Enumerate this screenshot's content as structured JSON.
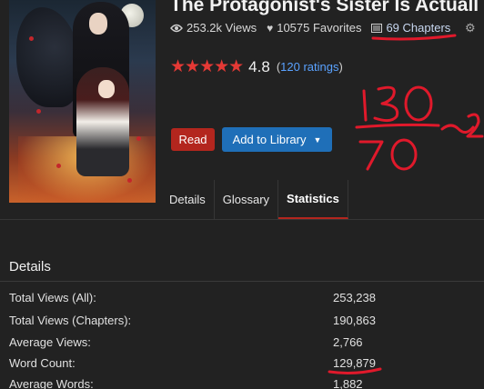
{
  "novel": {
    "title": "The Protagonist's Sister Is Actuall",
    "views": "253.2k Views",
    "favorites": "10575 Favorites",
    "chapters": "69 Chapters",
    "score": "4.8",
    "ratings_open": "(",
    "ratings_link": "120 ratings",
    "ratings_close": ")",
    "stars_glyphs": "★★★★★"
  },
  "icons": {
    "views": "eye-icon",
    "favorites": "heart-icon",
    "chapters": "list-icon",
    "settings": "gear-icon"
  },
  "actions": {
    "read_label": "Read",
    "library_label": "Add to Library"
  },
  "tabs": [
    {
      "label": "Details"
    },
    {
      "label": "Glossary"
    },
    {
      "label": "Statistics",
      "active": true
    }
  ],
  "details": {
    "heading": "Details",
    "rows": [
      {
        "label": "Total Views (All):",
        "value": "253,238"
      },
      {
        "label": "Total Views (Chapters):",
        "value": "190,863"
      },
      {
        "label": "Average Views:",
        "value": "2,766"
      },
      {
        "label": "Word Count:",
        "value": "129,879"
      },
      {
        "label": "Average Words:",
        "value": "1,882"
      }
    ]
  },
  "annotations": {
    "handwriting_top": "130",
    "handwriting_bottom": "70",
    "handwriting_side": "~2",
    "ink_color": "#e0192b"
  },
  "colors": {
    "accent_red": "#b3261e",
    "accent_blue": "#1f6fb8",
    "link_blue": "#5aa2ff",
    "background": "#222222"
  }
}
